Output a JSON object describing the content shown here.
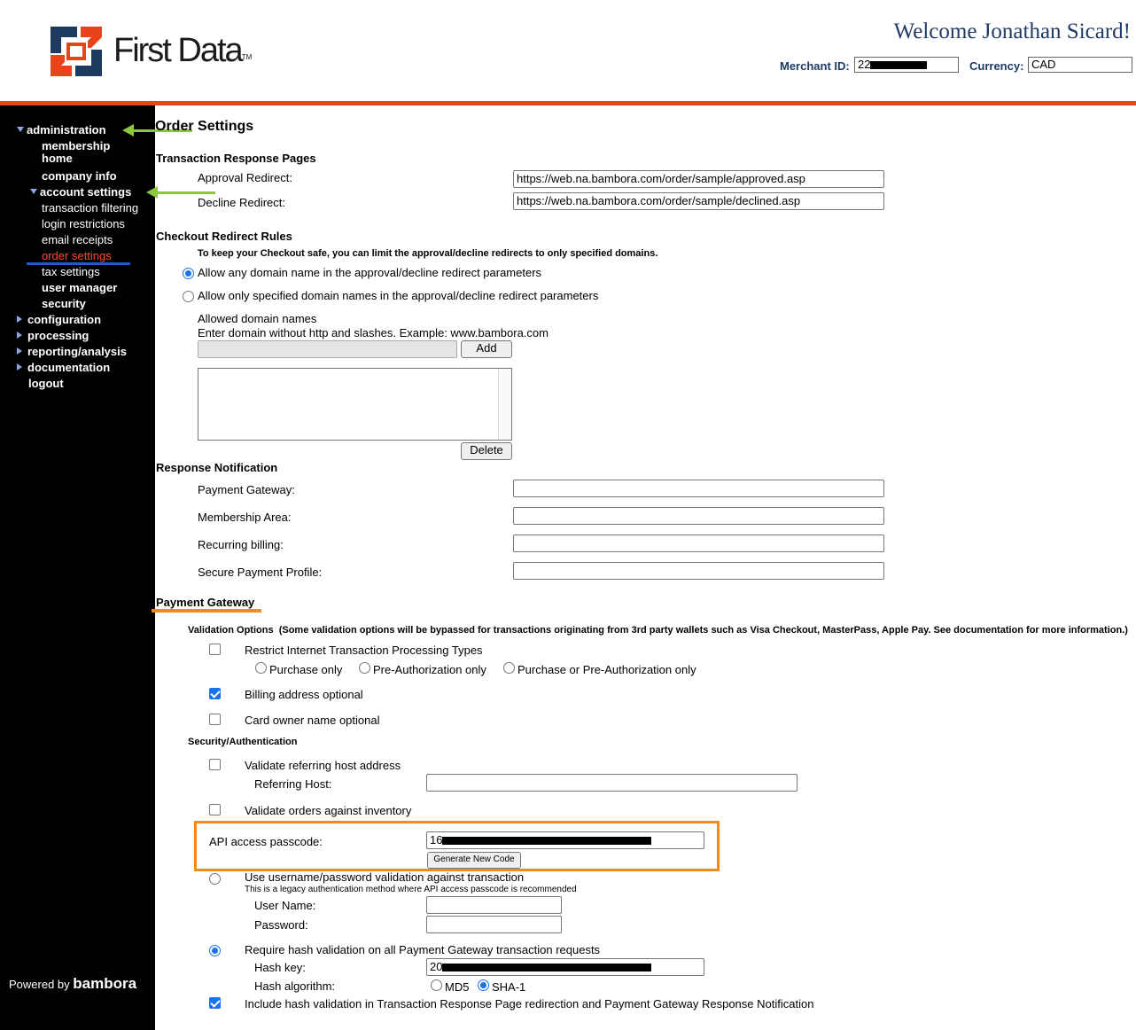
{
  "header": {
    "brand": "First Data",
    "brand_tm": "TM",
    "welcome": "Welcome Jonathan Sicard!",
    "merchant_label": "Merchant ID:",
    "merchant_value": "22",
    "currency_label": "Currency:",
    "currency_value": "CAD",
    "accent_color": "#e8431b"
  },
  "sidebar": {
    "items": [
      {
        "label": "administration"
      },
      {
        "label": "membership home"
      },
      {
        "label": "company info"
      },
      {
        "label": "account settings"
      },
      {
        "label": "transaction filtering"
      },
      {
        "label": "login restrictions"
      },
      {
        "label": "email receipts"
      },
      {
        "label": "order settings"
      },
      {
        "label": "tax settings"
      },
      {
        "label": "user manager"
      },
      {
        "label": "security"
      },
      {
        "label": "configuration"
      },
      {
        "label": "processing"
      },
      {
        "label": "reporting/analysis"
      },
      {
        "label": "documentation"
      },
      {
        "label": "logout"
      }
    ],
    "powered_by": "Powered by",
    "powered_brand": "bambora"
  },
  "main": {
    "title": "Order Settings",
    "trp": {
      "heading": "Transaction Response Pages",
      "approval_label": "Approval Redirect:",
      "approval_value": "https://web.na.bambora.com/order/sample/approved.asp",
      "decline_label": "Decline Redirect:",
      "decline_value": "https://web.na.bambora.com/order/sample/declined.asp"
    },
    "checkout": {
      "heading": "Checkout Redirect Rules",
      "note": "To keep your Checkout safe, you can limit the approval/decline redirects to only specified domains.",
      "option_any": "Allow any domain name in the approval/decline redirect parameters",
      "option_specified": "Allow only specified domain names in the approval/decline redirect parameters",
      "allowed_label": "Allowed domain names",
      "allowed_hint": "Enter domain without http and slashes. Example: www.bambora.com",
      "add_label": "Add",
      "delete_label": "Delete"
    },
    "notification": {
      "heading": "Response Notification",
      "payment_gateway": "Payment Gateway:",
      "membership_area": "Membership Area:",
      "recurring_billing": "Recurring billing:",
      "secure_payment_profile": "Secure Payment Profile:"
    },
    "payment_gateway": {
      "heading": "Payment Gateway",
      "validation_title": "Validation Options",
      "validation_note": "(Some validation options will be bypassed for transactions originating from 3rd party wallets such as Visa Checkout, MasterPass, Apple Pay. See documentation for more information.)",
      "restrict_label": "Restrict Internet Transaction Processing Types",
      "purchase_only": "Purchase only",
      "preauth_only": "Pre-Authorization only",
      "purchase_or_preauth": "Purchase or Pre-Authorization only",
      "billing_optional": "Billing address optional",
      "card_owner_optional": "Card owner name optional",
      "security_title": "Security/Authentication",
      "validate_host": "Validate referring host address",
      "referring_host": "Referring Host:",
      "validate_inventory": "Validate orders against inventory",
      "api_passcode_label": "API access passcode:",
      "api_passcode_value": "16",
      "generate_label": "Generate New Code",
      "username_validation": "Use username/password validation against transaction",
      "legacy_note": "This is a legacy authentication method where API access passcode is recommended",
      "username_label": "User Name:",
      "password_label": "Password:",
      "hash_validation": "Require hash validation on all Payment Gateway transaction requests",
      "hash_key_label": "Hash key:",
      "hash_key_value": "20",
      "hash_algo_label": "Hash algorithm:",
      "md5": "MD5",
      "sha1": "SHA-1",
      "include_hash": "Include hash validation in Transaction Response Page redirection and Payment Gateway Response Notification"
    }
  },
  "annotations": {
    "green": "#8dc63f",
    "orange": "#f28a1c",
    "blue": "#1d5bd6"
  }
}
